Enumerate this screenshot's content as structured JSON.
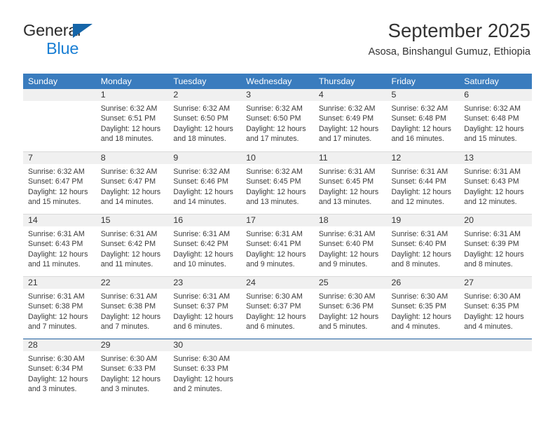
{
  "brand": {
    "line1": "General",
    "line2": "Blue",
    "triangle_color": "#1565a8",
    "blue_color": "#1a7fd4"
  },
  "header": {
    "title": "September 2025",
    "subtitle": "Asosa, Binshangul Gumuz, Ethiopia"
  },
  "colors": {
    "header_row": "#3a7cbe",
    "daynum_band": "#f0f0f0",
    "grid_line": "#d9d9d9",
    "accent_line": "#1f5fa0"
  },
  "weekdays": [
    "Sunday",
    "Monday",
    "Tuesday",
    "Wednesday",
    "Thursday",
    "Friday",
    "Saturday"
  ],
  "weeks": [
    [
      {
        "day": "",
        "lines": []
      },
      {
        "day": "1",
        "lines": [
          "Sunrise: 6:32 AM",
          "Sunset: 6:51 PM",
          "Daylight: 12 hours",
          "and 18 minutes."
        ]
      },
      {
        "day": "2",
        "lines": [
          "Sunrise: 6:32 AM",
          "Sunset: 6:50 PM",
          "Daylight: 12 hours",
          "and 18 minutes."
        ]
      },
      {
        "day": "3",
        "lines": [
          "Sunrise: 6:32 AM",
          "Sunset: 6:50 PM",
          "Daylight: 12 hours",
          "and 17 minutes."
        ]
      },
      {
        "day": "4",
        "lines": [
          "Sunrise: 6:32 AM",
          "Sunset: 6:49 PM",
          "Daylight: 12 hours",
          "and 17 minutes."
        ]
      },
      {
        "day": "5",
        "lines": [
          "Sunrise: 6:32 AM",
          "Sunset: 6:48 PM",
          "Daylight: 12 hours",
          "and 16 minutes."
        ]
      },
      {
        "day": "6",
        "lines": [
          "Sunrise: 6:32 AM",
          "Sunset: 6:48 PM",
          "Daylight: 12 hours",
          "and 15 minutes."
        ]
      }
    ],
    [
      {
        "day": "7",
        "lines": [
          "Sunrise: 6:32 AM",
          "Sunset: 6:47 PM",
          "Daylight: 12 hours",
          "and 15 minutes."
        ]
      },
      {
        "day": "8",
        "lines": [
          "Sunrise: 6:32 AM",
          "Sunset: 6:47 PM",
          "Daylight: 12 hours",
          "and 14 minutes."
        ]
      },
      {
        "day": "9",
        "lines": [
          "Sunrise: 6:32 AM",
          "Sunset: 6:46 PM",
          "Daylight: 12 hours",
          "and 14 minutes."
        ]
      },
      {
        "day": "10",
        "lines": [
          "Sunrise: 6:32 AM",
          "Sunset: 6:45 PM",
          "Daylight: 12 hours",
          "and 13 minutes."
        ]
      },
      {
        "day": "11",
        "lines": [
          "Sunrise: 6:31 AM",
          "Sunset: 6:45 PM",
          "Daylight: 12 hours",
          "and 13 minutes."
        ]
      },
      {
        "day": "12",
        "lines": [
          "Sunrise: 6:31 AM",
          "Sunset: 6:44 PM",
          "Daylight: 12 hours",
          "and 12 minutes."
        ]
      },
      {
        "day": "13",
        "lines": [
          "Sunrise: 6:31 AM",
          "Sunset: 6:43 PM",
          "Daylight: 12 hours",
          "and 12 minutes."
        ]
      }
    ],
    [
      {
        "day": "14",
        "lines": [
          "Sunrise: 6:31 AM",
          "Sunset: 6:43 PM",
          "Daylight: 12 hours",
          "and 11 minutes."
        ]
      },
      {
        "day": "15",
        "lines": [
          "Sunrise: 6:31 AM",
          "Sunset: 6:42 PM",
          "Daylight: 12 hours",
          "and 11 minutes."
        ]
      },
      {
        "day": "16",
        "lines": [
          "Sunrise: 6:31 AM",
          "Sunset: 6:42 PM",
          "Daylight: 12 hours",
          "and 10 minutes."
        ]
      },
      {
        "day": "17",
        "lines": [
          "Sunrise: 6:31 AM",
          "Sunset: 6:41 PM",
          "Daylight: 12 hours",
          "and 9 minutes."
        ]
      },
      {
        "day": "18",
        "lines": [
          "Sunrise: 6:31 AM",
          "Sunset: 6:40 PM",
          "Daylight: 12 hours",
          "and 9 minutes."
        ]
      },
      {
        "day": "19",
        "lines": [
          "Sunrise: 6:31 AM",
          "Sunset: 6:40 PM",
          "Daylight: 12 hours",
          "and 8 minutes."
        ]
      },
      {
        "day": "20",
        "lines": [
          "Sunrise: 6:31 AM",
          "Sunset: 6:39 PM",
          "Daylight: 12 hours",
          "and 8 minutes."
        ]
      }
    ],
    [
      {
        "day": "21",
        "lines": [
          "Sunrise: 6:31 AM",
          "Sunset: 6:38 PM",
          "Daylight: 12 hours",
          "and 7 minutes."
        ]
      },
      {
        "day": "22",
        "lines": [
          "Sunrise: 6:31 AM",
          "Sunset: 6:38 PM",
          "Daylight: 12 hours",
          "and 7 minutes."
        ]
      },
      {
        "day": "23",
        "lines": [
          "Sunrise: 6:31 AM",
          "Sunset: 6:37 PM",
          "Daylight: 12 hours",
          "and 6 minutes."
        ]
      },
      {
        "day": "24",
        "lines": [
          "Sunrise: 6:30 AM",
          "Sunset: 6:37 PM",
          "Daylight: 12 hours",
          "and 6 minutes."
        ]
      },
      {
        "day": "25",
        "lines": [
          "Sunrise: 6:30 AM",
          "Sunset: 6:36 PM",
          "Daylight: 12 hours",
          "and 5 minutes."
        ]
      },
      {
        "day": "26",
        "lines": [
          "Sunrise: 6:30 AM",
          "Sunset: 6:35 PM",
          "Daylight: 12 hours",
          "and 4 minutes."
        ]
      },
      {
        "day": "27",
        "lines": [
          "Sunrise: 6:30 AM",
          "Sunset: 6:35 PM",
          "Daylight: 12 hours",
          "and 4 minutes."
        ]
      }
    ],
    [
      {
        "day": "28",
        "lines": [
          "Sunrise: 6:30 AM",
          "Sunset: 6:34 PM",
          "Daylight: 12 hours",
          "and 3 minutes."
        ]
      },
      {
        "day": "29",
        "lines": [
          "Sunrise: 6:30 AM",
          "Sunset: 6:33 PM",
          "Daylight: 12 hours",
          "and 3 minutes."
        ]
      },
      {
        "day": "30",
        "lines": [
          "Sunrise: 6:30 AM",
          "Sunset: 6:33 PM",
          "Daylight: 12 hours",
          "and 2 minutes."
        ]
      },
      {
        "day": "",
        "lines": []
      },
      {
        "day": "",
        "lines": []
      },
      {
        "day": "",
        "lines": []
      },
      {
        "day": "",
        "lines": []
      }
    ]
  ]
}
